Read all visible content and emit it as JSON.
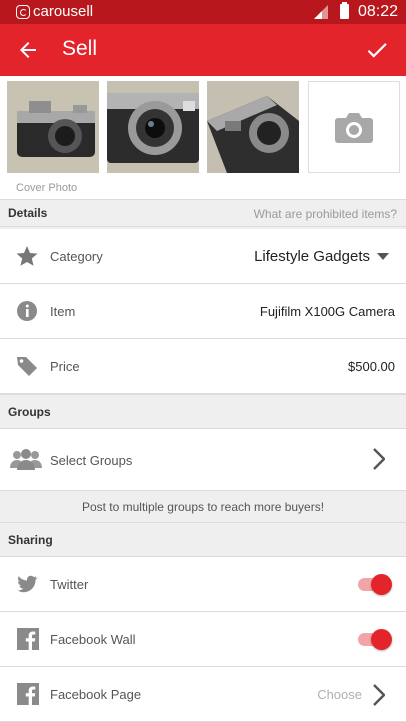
{
  "status_bar": {
    "brand": "carousell",
    "time": "08:22"
  },
  "app_bar": {
    "title": "Sell"
  },
  "photos": {
    "cover_label": "Cover Photo"
  },
  "details": {
    "heading": "Details",
    "prohibited_link": "What are prohibited items?",
    "category_label": "Category",
    "category_value": "Lifestyle Gadgets",
    "item_label": "Item",
    "item_value": "Fujifilm X100G Camera",
    "price_label": "Price",
    "price_value": "$500.00"
  },
  "groups": {
    "heading": "Groups",
    "select_label": "Select Groups",
    "hint": "Post to multiple groups to reach more buyers!"
  },
  "sharing": {
    "heading": "Sharing",
    "twitter_label": "Twitter",
    "twitter_on": true,
    "facebook_wall_label": "Facebook Wall",
    "facebook_wall_on": true,
    "facebook_page_label": "Facebook Page",
    "facebook_page_value": "Choose"
  },
  "colors": {
    "accent": "#e3242b",
    "status_bar": "#b8171d"
  }
}
